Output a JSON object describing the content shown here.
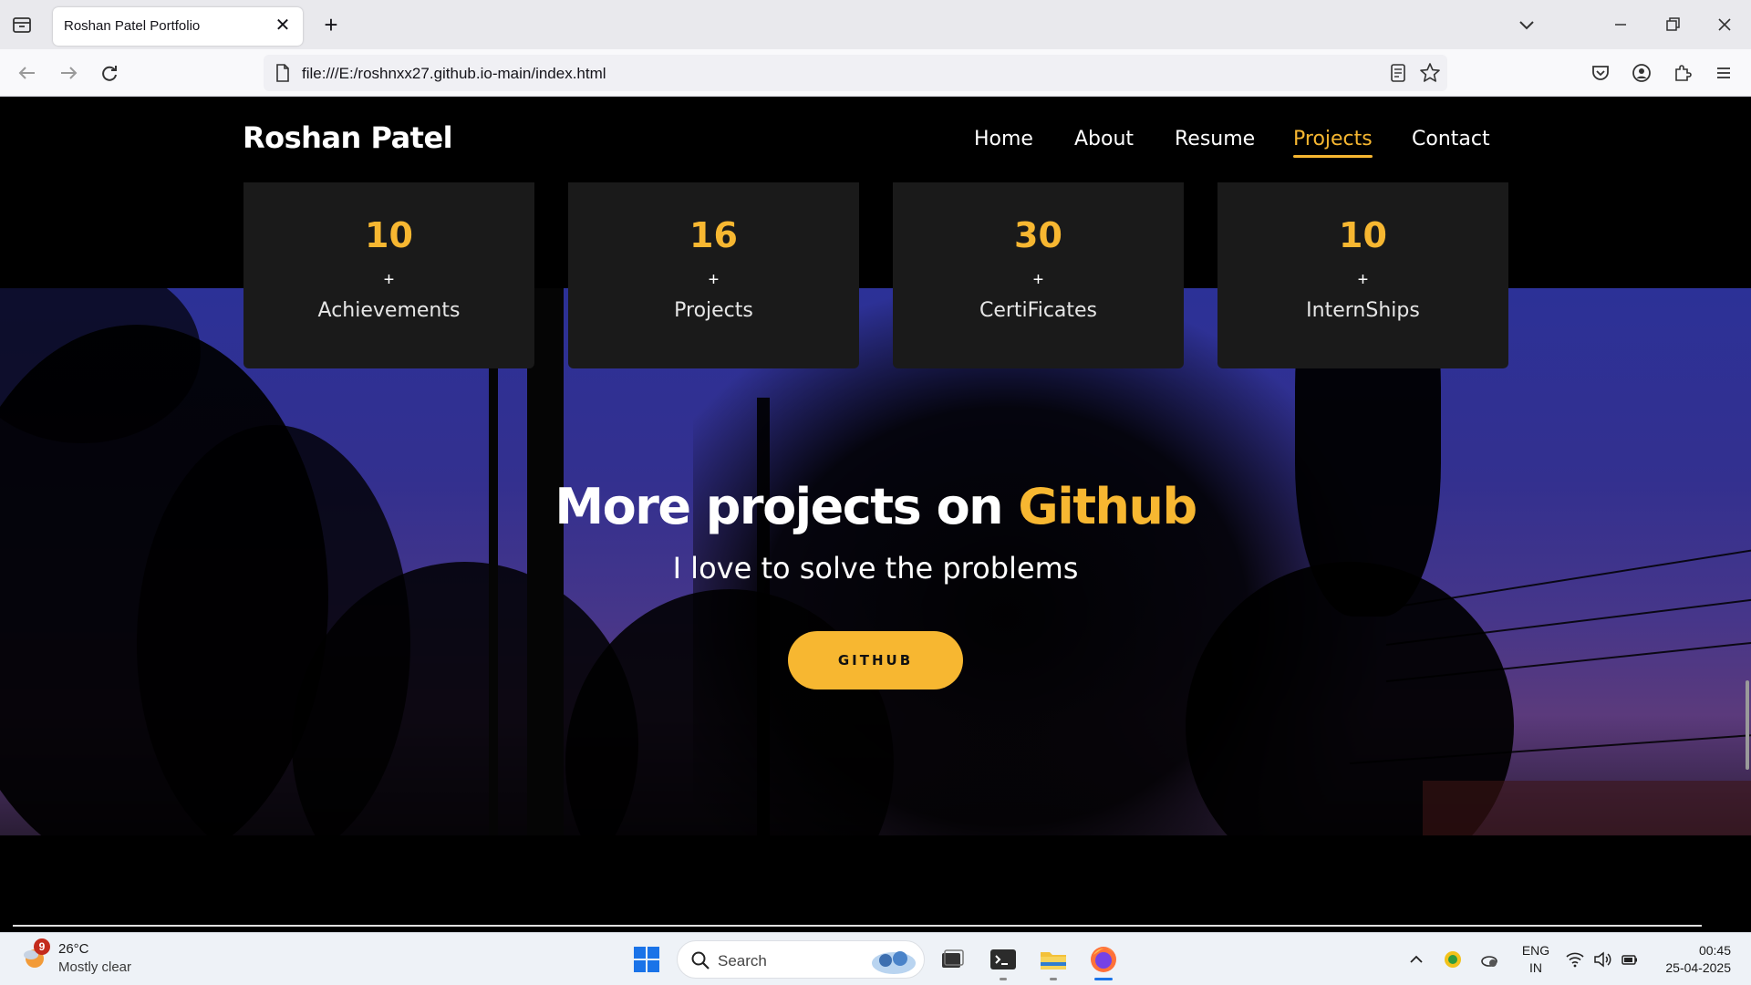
{
  "browser": {
    "tab_title": "Roshan Patel Portfolio",
    "tab_close": "✕",
    "new_tab": "+",
    "url": "file:///E:/roshnxx27.github.io-main/index.html"
  },
  "site": {
    "logo": "Roshan Patel",
    "nav": [
      {
        "label": "Home",
        "active": false
      },
      {
        "label": "About",
        "active": false
      },
      {
        "label": "Resume",
        "active": false
      },
      {
        "label": "Projects",
        "active": true
      },
      {
        "label": "Contact",
        "active": false
      }
    ],
    "stats": [
      {
        "value": "10",
        "plus": "+",
        "label": "Achievements"
      },
      {
        "value": "16",
        "plus": "+",
        "label": "Projects"
      },
      {
        "value": "30",
        "plus": "+",
        "label": "CertiFicates"
      },
      {
        "value": "10",
        "plus": "+",
        "label": "InternShips"
      }
    ],
    "hero": {
      "title_prefix": "More projects on ",
      "title_accent": "Github",
      "subtitle": "I love to solve the problems",
      "button": "GITHUB"
    },
    "colors": {
      "accent": "#f7b731",
      "background": "#000000",
      "card": "#1a1a1a"
    }
  },
  "taskbar": {
    "weather": {
      "badge": "9",
      "temp": "26°C",
      "desc": "Mostly clear"
    },
    "search_placeholder": "Search",
    "lang": {
      "line1": "ENG",
      "line2": "IN"
    },
    "clock": {
      "time": "00:45",
      "date": "25-04-2025"
    }
  }
}
